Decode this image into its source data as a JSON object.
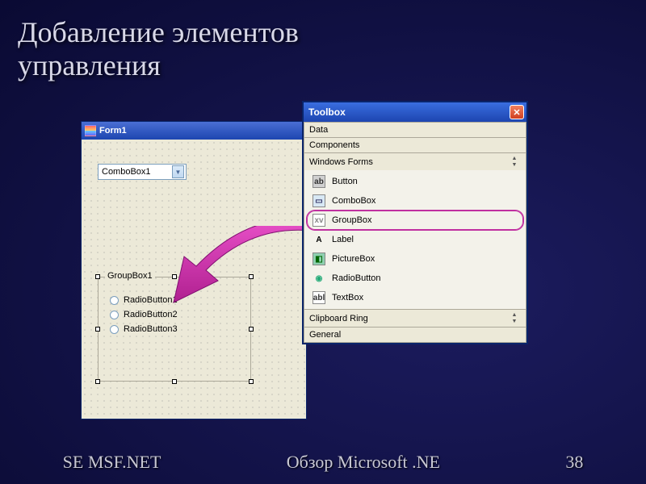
{
  "slide": {
    "title_line1": "Добавление элементов",
    "title_line2": "управления"
  },
  "form": {
    "title": "Form1",
    "combobox_value": "ComboBox1",
    "groupbox_label": "GroupBox1",
    "radios": [
      "RadioButton1",
      "RadioButton2",
      "RadioButton3"
    ]
  },
  "toolbox": {
    "title": "Toolbox",
    "sections_top": [
      "Data",
      "Components",
      "Windows Forms"
    ],
    "tools": [
      {
        "glyph": "ab",
        "label": "Button",
        "glyph_bg": "#d0d0d0",
        "glyph_color": "#333"
      },
      {
        "glyph": "▭",
        "label": "ComboBox",
        "glyph_bg": "#d8e8f4",
        "glyph_color": "#336"
      },
      {
        "glyph": "xv",
        "label": "GroupBox",
        "glyph_bg": "#fff",
        "glyph_color": "#888",
        "highlight": true
      },
      {
        "glyph": "A",
        "label": "Label",
        "glyph_bg": "transparent",
        "glyph_color": "#000"
      },
      {
        "glyph": "◧",
        "label": "PictureBox",
        "glyph_bg": "#8fd0b0",
        "glyph_color": "#060"
      },
      {
        "glyph": "◉",
        "label": "RadioButton",
        "glyph_bg": "transparent",
        "glyph_color": "#2a7"
      },
      {
        "glyph": "abl",
        "label": "TextBox",
        "glyph_bg": "#fff",
        "glyph_color": "#333"
      }
    ],
    "sections_bottom": [
      "Clipboard Ring",
      "General"
    ]
  },
  "footer": {
    "left": "SE MSF.NET",
    "center": "Обзор Microsoft .NE",
    "right": "38"
  },
  "colors": {
    "highlight": "#c030a0"
  }
}
